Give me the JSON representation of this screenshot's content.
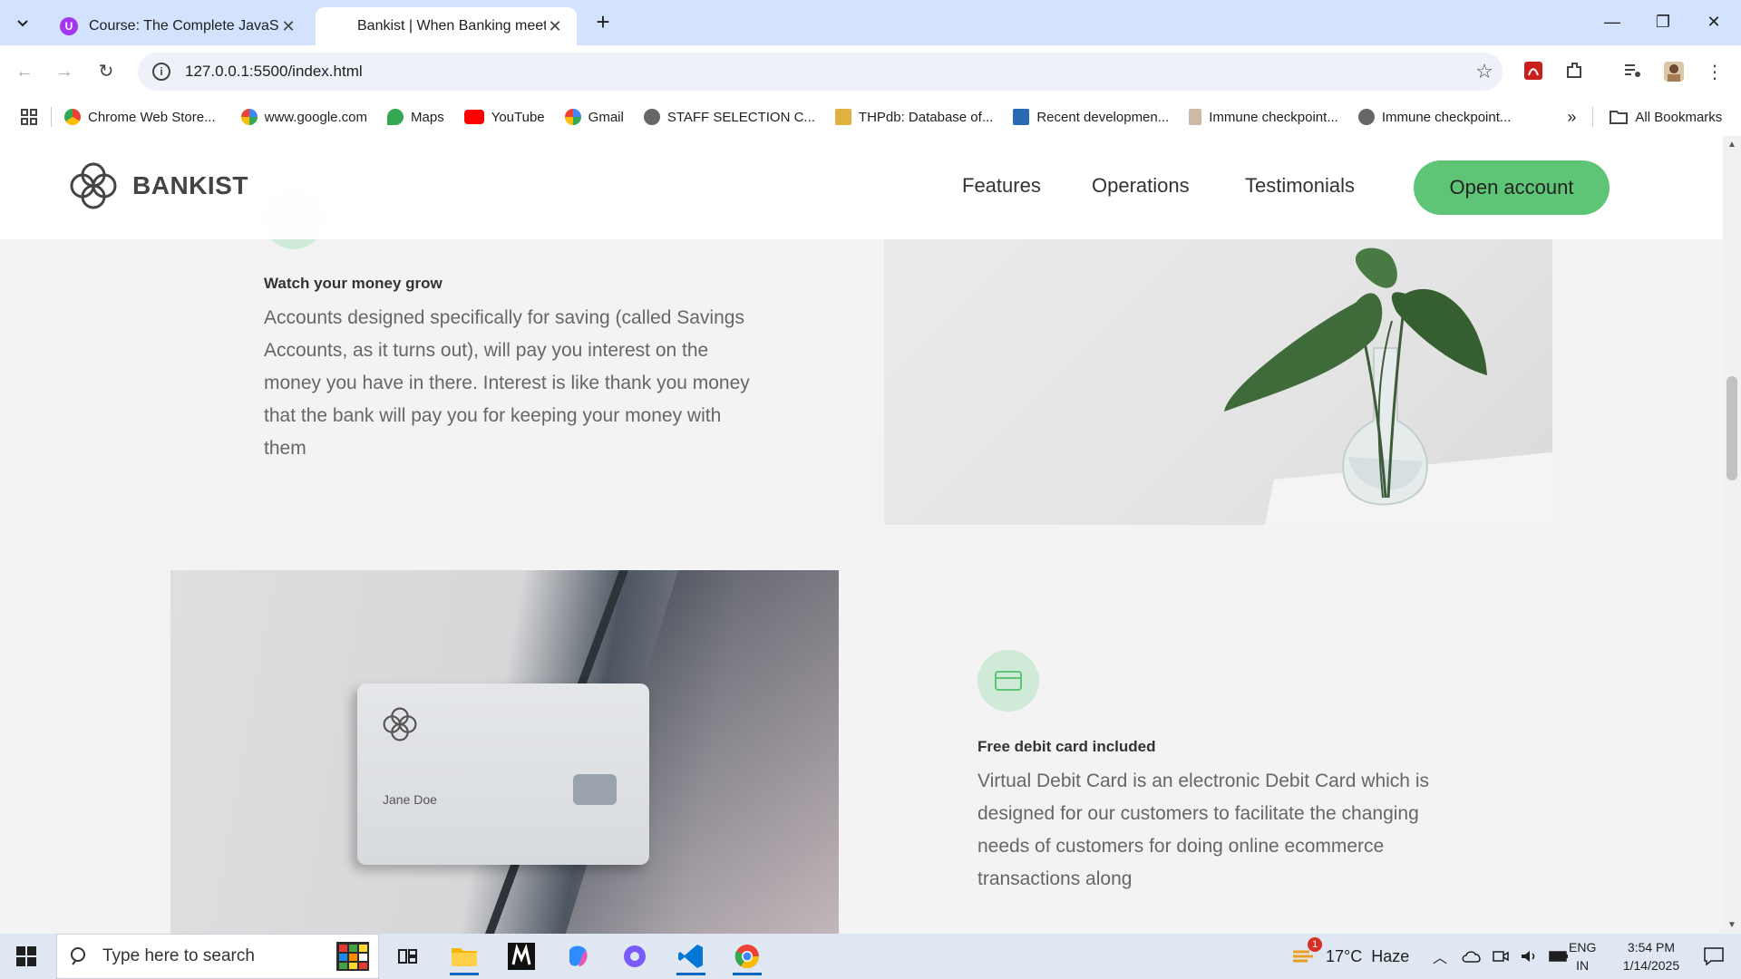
{
  "browser": {
    "tabs": [
      {
        "title": "Course: The Complete JavaScrip",
        "active": false
      },
      {
        "title": "Bankist | When Banking meets ",
        "active": true
      }
    ],
    "url": "127.0.0.1:5500/index.html",
    "bookmarks": [
      {
        "label": "Chrome Web Store...",
        "icon": "chrome-web-store-icon"
      },
      {
        "label": "www.google.com",
        "icon": "google-icon"
      },
      {
        "label": "Maps",
        "icon": "maps-icon"
      },
      {
        "label": "YouTube",
        "icon": "youtube-icon"
      },
      {
        "label": "Gmail",
        "icon": "google-icon"
      },
      {
        "label": "STAFF SELECTION C...",
        "icon": "globe-icon"
      },
      {
        "label": "THPdb: Database of...",
        "icon": "thpdb-icon"
      },
      {
        "label": "Recent developmen...",
        "icon": "article-icon"
      },
      {
        "label": "Immune checkpoint...",
        "icon": "article-icon"
      },
      {
        "label": "Immune checkpoint...",
        "icon": "globe-icon"
      }
    ],
    "all_bookmarks_label": "All Bookmarks"
  },
  "site": {
    "logo_text": "BANKIST",
    "nav": [
      "Features",
      "Operations",
      "Testimonials"
    ],
    "cta": "Open account",
    "features": [
      {
        "title": "Watch your money grow",
        "body": "Accounts designed specifically for saving (called Savings Accounts, as it turns out), will pay you interest on the money you have in there. Interest is like thank you money that the bank will pay you for keeping your money with them"
      },
      {
        "title": "Free debit card included",
        "body": "Virtual Debit Card is an electronic Debit Card which is designed for our customers to facilitate the changing needs of customers for doing online ecommerce transactions along"
      }
    ],
    "card_name": "Jane Doe",
    "accent_color": "#5ec576"
  },
  "taskbar": {
    "search_placeholder": "Type here to search",
    "weather": "17°C  Haze",
    "weather_badge": "1",
    "lang_top": "ENG",
    "lang_bottom": "IN",
    "time": "3:54 PM",
    "date": "1/14/2025"
  }
}
